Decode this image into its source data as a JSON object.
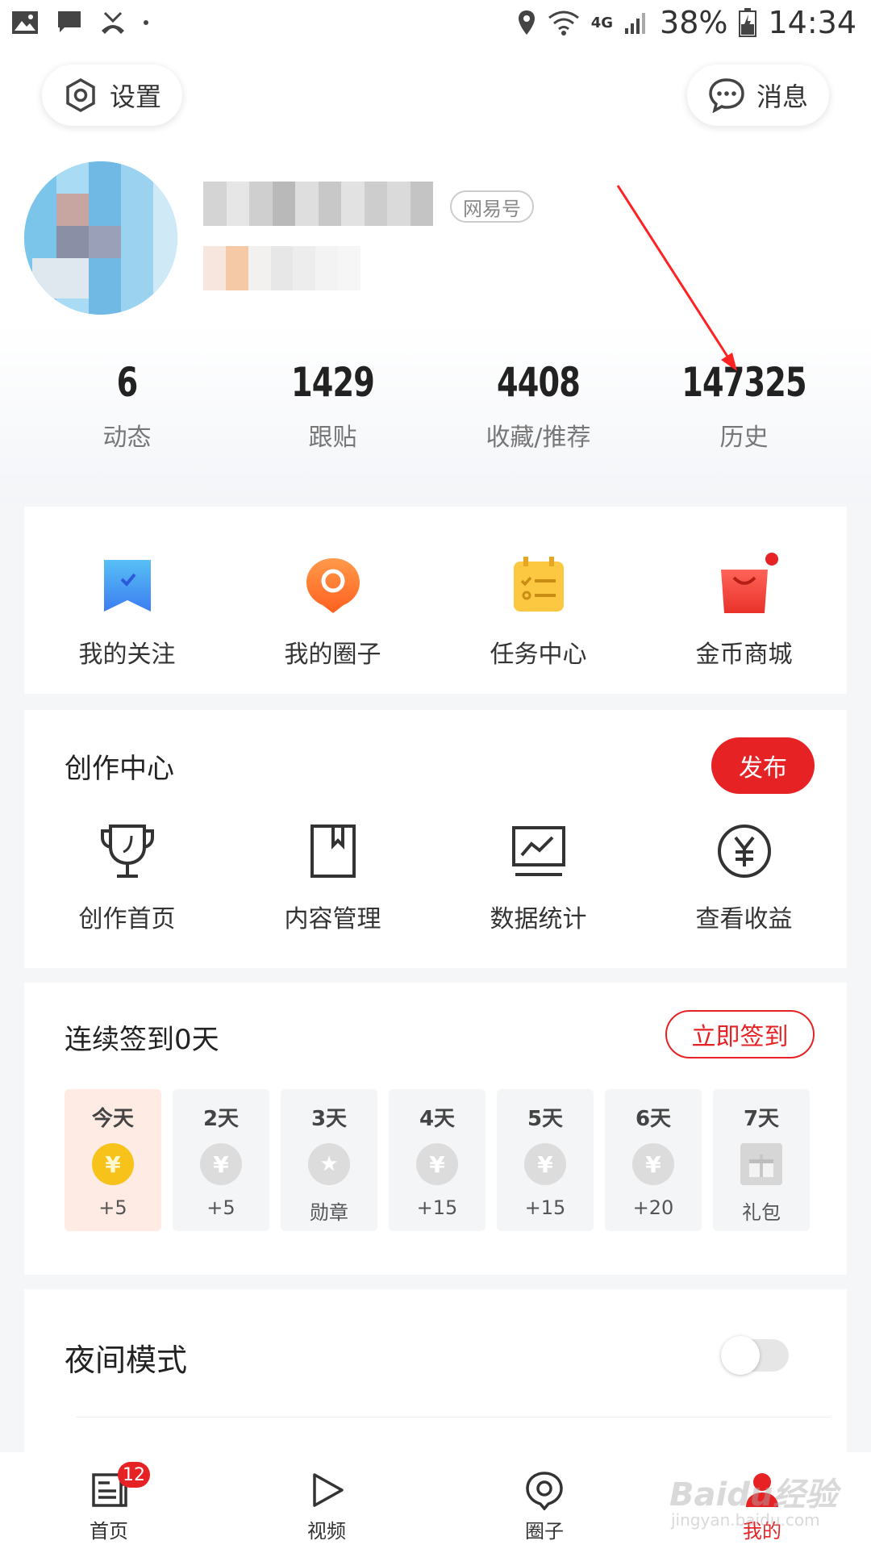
{
  "status_bar": {
    "battery": "38%",
    "network": "4G",
    "time": "14:34"
  },
  "top_buttons": {
    "settings_label": "设置",
    "messages_label": "消息"
  },
  "profile": {
    "tag": "网易号"
  },
  "stats": [
    {
      "value": "6",
      "label": "动态"
    },
    {
      "value": "1429",
      "label": "跟贴"
    },
    {
      "value": "4408",
      "label": "收藏/推荐"
    },
    {
      "value": "147325",
      "label": "历史"
    }
  ],
  "quick_links": [
    {
      "label": "我的关注",
      "icon": "bookmark-icon"
    },
    {
      "label": "我的圈子",
      "icon": "circle-chat-icon"
    },
    {
      "label": "任务中心",
      "icon": "task-list-icon"
    },
    {
      "label": "金币商城",
      "icon": "shopping-bag-icon"
    }
  ],
  "creation_center": {
    "title": "创作中心",
    "publish_label": "发布",
    "items": [
      {
        "label": "创作首页",
        "icon": "trophy-icon"
      },
      {
        "label": "内容管理",
        "icon": "book-icon"
      },
      {
        "label": "数据统计",
        "icon": "chart-monitor-icon"
      },
      {
        "label": "查看收益",
        "icon": "yen-coin-icon"
      }
    ]
  },
  "signin": {
    "title": "连续签到0天",
    "button_label": "立即签到",
    "days": [
      {
        "day": "今天",
        "reward": "+5",
        "symbol": "¥"
      },
      {
        "day": "2天",
        "reward": "+5",
        "symbol": "¥"
      },
      {
        "day": "3天",
        "reward": "勋章",
        "symbol": "★"
      },
      {
        "day": "4天",
        "reward": "+15",
        "symbol": "¥"
      },
      {
        "day": "5天",
        "reward": "+15",
        "symbol": "¥"
      },
      {
        "day": "6天",
        "reward": "+20",
        "symbol": "¥"
      },
      {
        "day": "7天",
        "reward": "礼包",
        "symbol": "🎁"
      }
    ]
  },
  "night_mode": {
    "label": "夜间模式",
    "enabled": false
  },
  "tabbar": {
    "badge": "12",
    "items": [
      {
        "label": "首页",
        "icon": "news-icon"
      },
      {
        "label": "视频",
        "icon": "play-icon"
      },
      {
        "label": "圈子",
        "icon": "circle-icon"
      },
      {
        "label": "我的",
        "icon": "user-icon"
      }
    ]
  },
  "watermark": {
    "main": "Baidu经验",
    "sub": "jingyan.baidu.com"
  },
  "colors": {
    "accent": "#e62225",
    "coin_gold": "#f7c21a",
    "avatar_blue": "#8fd0ef"
  }
}
